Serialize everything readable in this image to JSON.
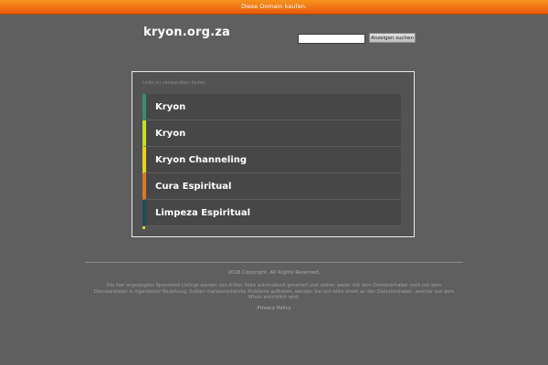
{
  "topbar": {
    "label": "Diese Domain kaufen."
  },
  "header": {
    "domain": "kryon.org.za",
    "search_placeholder": "",
    "search_button": "Anzeigen suchen"
  },
  "links": {
    "header": "Links zu verwandten Seiten",
    "items": [
      {
        "label": "Kryon",
        "accent": "#3c8a72"
      },
      {
        "label": "Kryon",
        "accent": "#c8dc28"
      },
      {
        "label": "Kryon Channeling",
        "accent": "#e8d21c"
      },
      {
        "label": "Cura Espiritual",
        "accent": "#d87a28"
      },
      {
        "label": "Limpeza Espiritual",
        "accent": "#1e4e5c"
      }
    ]
  },
  "footer": {
    "copyright": "2018 Copyright. All Rights Reserved.",
    "disclaimer": "Die hier angezeigten Sponsored Listings werden von dritter Seite automatisch generiert und stehen weder mit dem Domaininhaber noch mit dem Dienstanbieter in irgendeiner Beziehung. Sollten markenrechtliche Probleme auftreten, wenden Sie sich bitte direkt an den Domaininhaber, welcher aus dem Whois ersichtlich wird.",
    "privacy": "Privacy Policy"
  },
  "colors": {
    "background": "#5f5f5f",
    "topbar": "#f7931e"
  }
}
